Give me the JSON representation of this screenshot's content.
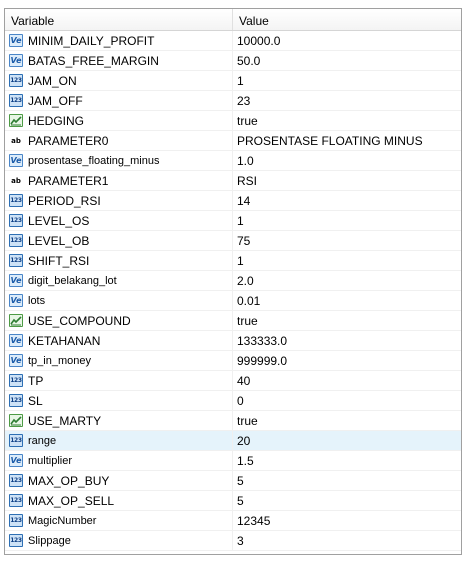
{
  "header": {
    "variable": "Variable",
    "value": "Value"
  },
  "rows": [
    {
      "name": "MINIM_DAILY_PROFIT",
      "value": "10000.0",
      "type": "double"
    },
    {
      "name": "BATAS_FREE_MARGIN",
      "value": "50.0",
      "type": "double"
    },
    {
      "name": "JAM_ON",
      "value": "1",
      "type": "int"
    },
    {
      "name": "JAM_OFF",
      "value": "23",
      "type": "int"
    },
    {
      "name": "HEDGING",
      "value": "true",
      "type": "bool"
    },
    {
      "name": "PARAMETER0",
      "value": "PROSENTASE FLOATING MINUS",
      "type": "string"
    },
    {
      "name": "prosentase_floating_minus",
      "value": "1.0",
      "type": "double"
    },
    {
      "name": "PARAMETER1",
      "value": "RSI",
      "type": "string"
    },
    {
      "name": "PERIOD_RSI",
      "value": "14",
      "type": "int"
    },
    {
      "name": "LEVEL_OS",
      "value": "1",
      "type": "int"
    },
    {
      "name": "LEVEL_OB",
      "value": "75",
      "type": "int"
    },
    {
      "name": "SHIFT_RSI",
      "value": "1",
      "type": "int"
    },
    {
      "name": "digit_belakang_lot",
      "value": "2.0",
      "type": "double"
    },
    {
      "name": "lots",
      "value": "0.01",
      "type": "double"
    },
    {
      "name": "USE_COMPOUND",
      "value": "true",
      "type": "bool"
    },
    {
      "name": "KETAHANAN",
      "value": "133333.0",
      "type": "double"
    },
    {
      "name": "tp_in_money",
      "value": "999999.0",
      "type": "double"
    },
    {
      "name": "TP",
      "value": "40",
      "type": "int"
    },
    {
      "name": "SL",
      "value": "0",
      "type": "int"
    },
    {
      "name": "USE_MARTY",
      "value": "true",
      "type": "bool"
    },
    {
      "name": "range",
      "value": "20",
      "type": "int",
      "selected": true
    },
    {
      "name": "multiplier",
      "value": "1.5",
      "type": "double"
    },
    {
      "name": "MAX_OP_BUY",
      "value": "5",
      "type": "int"
    },
    {
      "name": "MAX_OP_SELL",
      "value": "5",
      "type": "int"
    },
    {
      "name": "MagicNumber",
      "value": "12345",
      "type": "int"
    },
    {
      "name": "Slippage",
      "value": "3",
      "type": "int"
    }
  ],
  "icons": {
    "double": {
      "name": "double-type-icon",
      "glyph": "Ve"
    },
    "int": {
      "name": "integer-type-icon",
      "glyph": "123"
    },
    "bool": {
      "name": "boolean-type-icon",
      "glyph": ""
    },
    "string": {
      "name": "string-type-icon",
      "glyph": "ab"
    }
  }
}
